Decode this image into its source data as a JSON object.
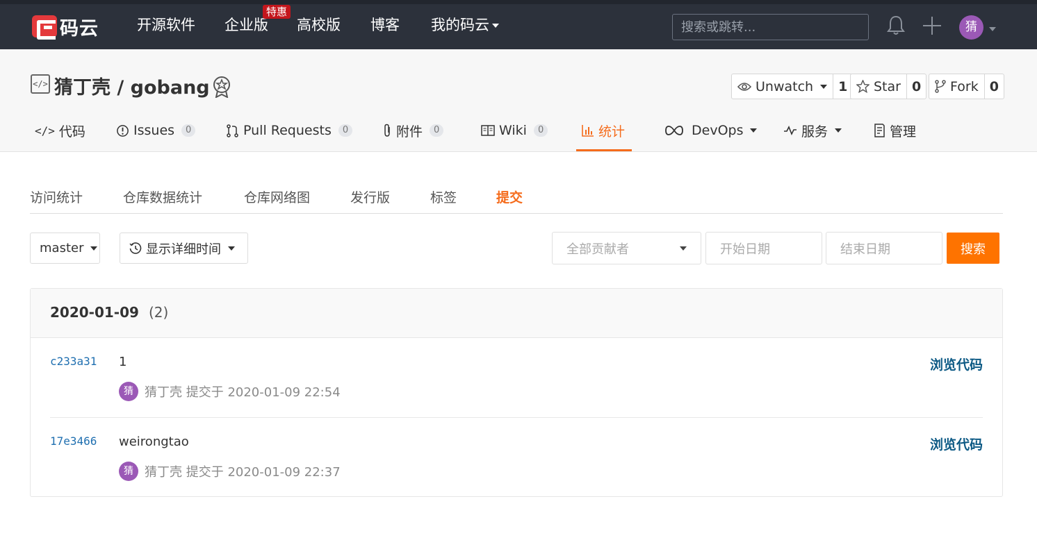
{
  "topnav": {
    "logo_text": "码云",
    "items": [
      {
        "label": "开源软件"
      },
      {
        "label": "企业版"
      },
      {
        "label": "高校版"
      },
      {
        "label": "博客"
      },
      {
        "label": "我的码云"
      }
    ],
    "badge": "特惠",
    "search_placeholder": "搜索或跳转...",
    "avatar_char": "猜"
  },
  "repo": {
    "title": "猜丁壳 / gobang",
    "watch": {
      "label": "Unwatch",
      "count": "1"
    },
    "star": {
      "label": "Star",
      "count": "0"
    },
    "fork": {
      "label": "Fork",
      "count": "0"
    }
  },
  "tabs": [
    {
      "label": "代码"
    },
    {
      "label": "Issues",
      "count": "0"
    },
    {
      "label": "Pull Requests",
      "count": "0"
    },
    {
      "label": "附件",
      "count": "0"
    },
    {
      "label": "Wiki",
      "count": "0"
    },
    {
      "label": "统计"
    },
    {
      "label": "DevOps"
    },
    {
      "label": "服务"
    },
    {
      "label": "管理"
    }
  ],
  "subtabs": [
    {
      "label": "访问统计"
    },
    {
      "label": "仓库数据统计"
    },
    {
      "label": "仓库网络图"
    },
    {
      "label": "发行版"
    },
    {
      "label": "标签"
    },
    {
      "label": "提交"
    }
  ],
  "filters": {
    "branch": "master",
    "time_mode": "显示详细时间",
    "contributors_placeholder": "全部贡献者",
    "start_placeholder": "开始日期",
    "end_placeholder": "结束日期",
    "search_label": "搜索"
  },
  "commit_group": {
    "date": "2020-01-09",
    "count": "(2)",
    "commits": [
      {
        "sha": "c233a31",
        "message": "1",
        "avatar_char": "猜",
        "meta": "猜丁壳 提交于 2020-01-09 22:54",
        "browse": "浏览代码"
      },
      {
        "sha": "17e3466",
        "message": "weirongtao",
        "avatar_char": "猜",
        "meta": "猜丁壳 提交于 2020-01-09 22:37",
        "browse": "浏览代码"
      }
    ]
  },
  "colors": {
    "accent": "#f56c1c",
    "nav_bg": "#2c313b",
    "link": "#0d5a85"
  }
}
